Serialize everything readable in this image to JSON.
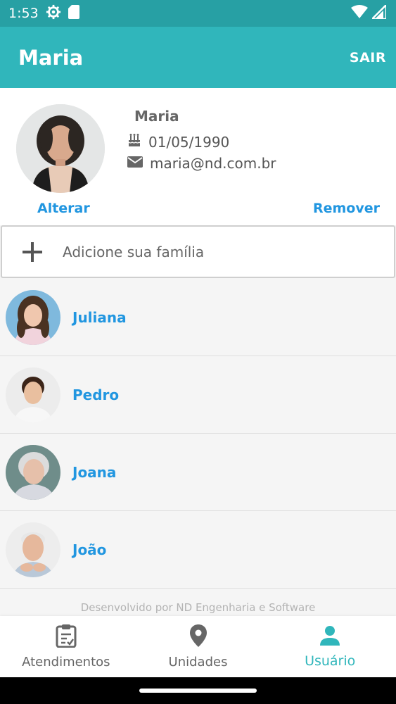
{
  "status_bar": {
    "time": "1:53",
    "icons": [
      "settings-icon",
      "sd-card-icon",
      "wifi-icon",
      "signal-icon"
    ]
  },
  "app_bar": {
    "title": "Maria",
    "logout_label": "SAIR"
  },
  "profile": {
    "name": "Maria",
    "birth_date": "01/05/1990",
    "email": "maria@nd.com.br",
    "change_photo_label": "Alterar",
    "remove_photo_label": "Remover"
  },
  "add_family": {
    "label": "Adicione sua família"
  },
  "family": [
    {
      "name": "Juliana"
    },
    {
      "name": "Pedro"
    },
    {
      "name": "Joana"
    },
    {
      "name": "João"
    }
  ],
  "footer": {
    "credit": "Desenvolvido por ND Engenharia e Software"
  },
  "bottom_nav": {
    "items": [
      {
        "label": "Atendimentos",
        "icon": "clipboard-icon",
        "active": false
      },
      {
        "label": "Unidades",
        "icon": "map-pin-icon",
        "active": false
      },
      {
        "label": "Usuário",
        "icon": "person-icon",
        "active": true
      }
    ]
  },
  "colors": {
    "status_bar": "#27a0a4",
    "app_bar": "#30b6bb",
    "link": "#2196e0",
    "nav_active": "#30b6bb"
  }
}
